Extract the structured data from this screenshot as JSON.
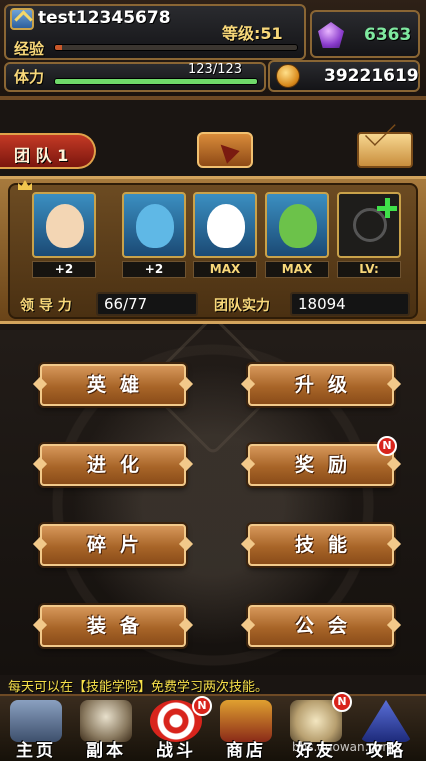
{
  "player": {
    "username": "test12345678",
    "level_text": "等级:51",
    "exp_label": "经验",
    "exp_progress": 0.03,
    "stamina_label": "体力",
    "stamina_text": "123/123",
    "stamina_progress": 1.0
  },
  "currency": {
    "gems": "6363",
    "gold": "39221619"
  },
  "team": {
    "tab_label": "团 队 1",
    "heroes": [
      {
        "label": "+2",
        "label_color": "#ffffff",
        "color": "#f3d6b4"
      },
      {
        "label": "+2",
        "label_color": "#ffffff",
        "color": "#5fb8e6"
      },
      {
        "label": "MAX",
        "label_color": "#f8d87a",
        "color": "#ffffff"
      },
      {
        "label": "MAX",
        "label_color": "#f8d87a",
        "color": "#6cc24a"
      },
      {
        "label": "LV:",
        "label_color": "#f8d87a",
        "color": "#333333"
      }
    ],
    "leadership_label": "领 导 力",
    "leadership_value": "66/77",
    "power_label": "团队实力",
    "power_value": "18094"
  },
  "menu": {
    "heroes": "英雄",
    "upgrade": "升级",
    "evolve": "进化",
    "reward": "奖励",
    "fragments": "碎片",
    "skills": "技能",
    "equipment": "装备",
    "guild": "公会",
    "new_badge": "N"
  },
  "tip": "每天可以在【技能学院】免费学习两次技能。",
  "nav": {
    "home": "主页",
    "dungeon": "副本",
    "battle": "战斗",
    "shop": "商店",
    "friends": "好友",
    "guide": "攻略",
    "new_badge": "N"
  },
  "watermark": "bbs.duowan.com",
  "colors": {
    "exp_bar": "#c9582a",
    "stamina_bar": "#6fd96a",
    "gem_text": "#7fe9a0",
    "accent_gold": "#f8d87a"
  }
}
